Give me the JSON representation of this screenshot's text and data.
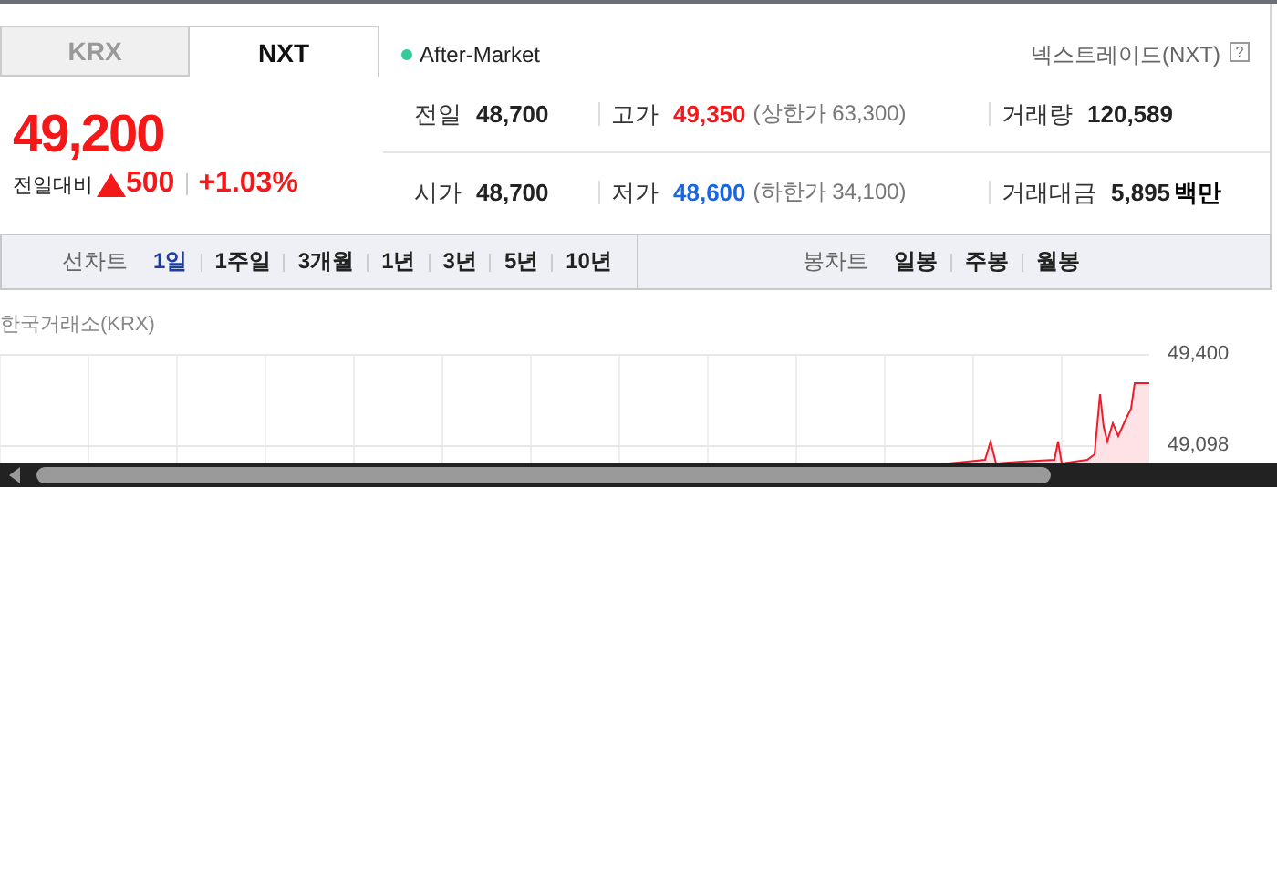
{
  "exchange_tabs": [
    {
      "label": "KRX",
      "selected": false
    },
    {
      "label": "NXT",
      "selected": true
    }
  ],
  "market_status": "After-Market",
  "exchange_name": "넥스트레이드(NXT)",
  "help_icon": "?",
  "price": {
    "current": "49,200",
    "change_label": "전일대비",
    "up": true,
    "change": "500",
    "change_rate": "+1.03%"
  },
  "stats": [
    {
      "label": "전일",
      "value": "48,700",
      "kind": "plain"
    },
    {
      "label": "고가",
      "value": "49,350",
      "kind": "up",
      "limit": "(상한가 63,300)"
    },
    {
      "label": "거래량",
      "value": "120,589",
      "kind": "plain"
    },
    {
      "label": "시가",
      "value": "48,700",
      "kind": "plain"
    },
    {
      "label": "저가",
      "value": "48,600",
      "kind": "down",
      "limit": "(하한가 34,100)"
    },
    {
      "label": "거래대금",
      "value": "5,895",
      "kind": "plain",
      "unit": "백만"
    }
  ],
  "line_chart_periods": {
    "label": "선차트",
    "items": [
      {
        "label": "1일",
        "selected": true
      },
      {
        "label": "1주일",
        "selected": false
      },
      {
        "label": "3개월",
        "selected": false
      },
      {
        "label": "1년",
        "selected": false
      },
      {
        "label": "3년",
        "selected": false
      },
      {
        "label": "5년",
        "selected": false
      },
      {
        "label": "10년",
        "selected": false
      }
    ]
  },
  "candle_chart_periods": {
    "label": "봉차트",
    "items": [
      {
        "label": "일봉",
        "selected": false
      },
      {
        "label": "주봉",
        "selected": false
      },
      {
        "label": "월봉",
        "selected": false
      }
    ]
  },
  "chart": {
    "title": "한국거래소(KRX)",
    "y_tick_labels": [
      "49,400",
      "49,098"
    ]
  }
}
